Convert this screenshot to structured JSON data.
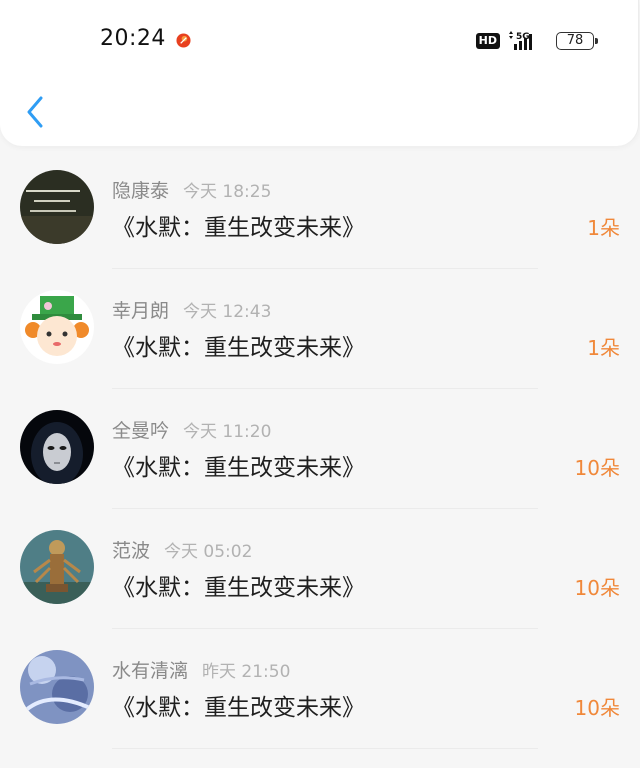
{
  "status_bar": {
    "time": "20:24",
    "hd": "HD",
    "network": "5G",
    "battery": "78"
  },
  "nav": {
    "back_icon": "chevron-left-icon",
    "back_color": "#2f9df4"
  },
  "colors": {
    "count_accent": "#f0883a"
  },
  "list": [
    {
      "name": "隐康泰",
      "time": "今天 18:25",
      "title": "《水默：重生改变未来》",
      "count": "1朵",
      "avatar": "dark-chalkboard-avatar"
    },
    {
      "name": "幸月朗",
      "time": "今天 12:43",
      "title": "《水默：重生改变未来》",
      "count": "1朵",
      "avatar": "cartoon-hat-avatar"
    },
    {
      "name": "全曼吟",
      "time": "今天 11:20",
      "title": "《水默：重生改变未来》",
      "count": "10朵",
      "avatar": "mask-avatar"
    },
    {
      "name": "范波",
      "time": "今天 05:02",
      "title": "《水默：重生改变未来》",
      "count": "10朵",
      "avatar": "statue-avatar"
    },
    {
      "name": "水有清漓",
      "time": "昨天 21:50",
      "title": "《水默：重生改变未来》",
      "count": "10朵",
      "avatar": "blue-art-avatar"
    }
  ]
}
